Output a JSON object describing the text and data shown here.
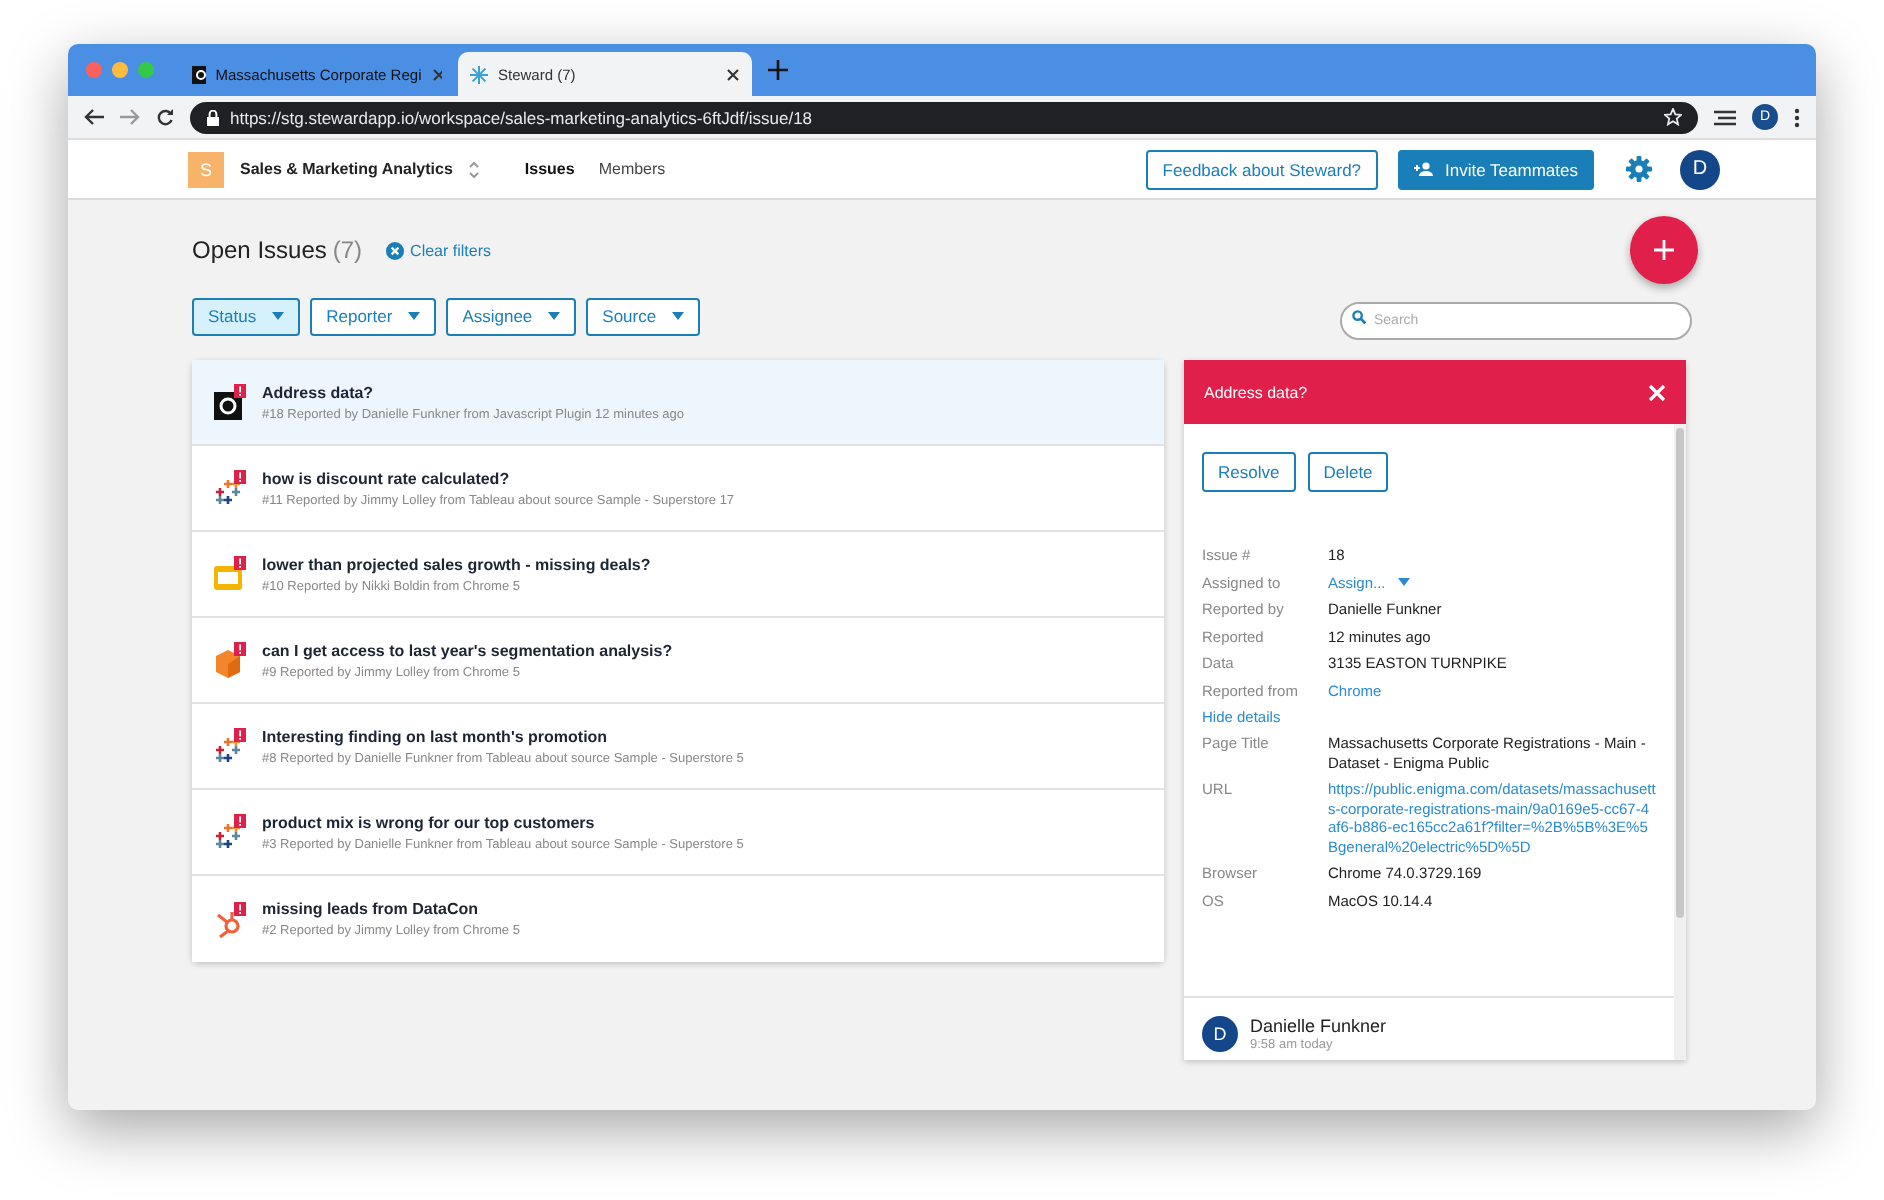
{
  "browser": {
    "tabs": [
      {
        "title": "Massachusetts Corporate Regi",
        "kind": "dark-tile",
        "selected": false
      },
      {
        "title": "Steward (7)",
        "kind": "sparkle",
        "selected": true
      }
    ],
    "url": "https://stg.stewardapp.io/workspace/sales-marketing-analytics-6ftJdf/issue/18",
    "profile_initial": "D"
  },
  "header": {
    "workspace": {
      "initial": "S",
      "name": "Sales & Marketing Analytics"
    },
    "nav": [
      {
        "label": "Issues",
        "selected": true
      },
      {
        "label": "Members",
        "selected": false
      }
    ],
    "feedback_button": "Feedback about Steward?",
    "invite_button": "Invite Teammates",
    "avatar_initial": "D"
  },
  "page": {
    "title": "Open Issues",
    "count": "(7)",
    "clear_filters": "Clear filters",
    "filters": [
      {
        "label": "Status",
        "active": true
      },
      {
        "label": "Reporter",
        "active": false
      },
      {
        "label": "Assignee",
        "active": false
      },
      {
        "label": "Source",
        "active": false
      }
    ],
    "search": {
      "placeholder": "Search"
    }
  },
  "issues": [
    {
      "title": "Address data?",
      "meta": "#18 Reported by Danielle Funkner from Javascript Plugin 12 minutes ago",
      "kind": "dark-tile",
      "selected": true
    },
    {
      "title": "how is discount rate calculated?",
      "meta": "#11 Reported by Jimmy Lolley from Tableau about source Sample - Superstore 17",
      "kind": "crosses",
      "selected": false
    },
    {
      "title": "lower than projected sales growth - missing deals?",
      "meta": "#10 Reported by Nikki Boldin from Chrome 5",
      "kind": "slide",
      "selected": false
    },
    {
      "title": "can I get access to last year's segmentation analysis?",
      "meta": "#9 Reported by Jimmy Lolley from Chrome 5",
      "kind": "cube",
      "selected": false
    },
    {
      "title": "Interesting finding on last month's promotion",
      "meta": "#8 Reported by Danielle Funkner from Tableau about source Sample - Superstore 5",
      "kind": "crosses",
      "selected": false
    },
    {
      "title": "product mix is wrong for our top customers",
      "meta": "#3 Reported by Danielle Funkner from Tableau about source Sample - Superstore 5",
      "kind": "crosses",
      "selected": false
    },
    {
      "title": "missing leads from DataCon",
      "meta": "#2 Reported by Jimmy Lolley from Chrome 5",
      "kind": "sprocket",
      "selected": false
    }
  ],
  "detail": {
    "title": "Address data?",
    "actions": [
      "Resolve",
      "Delete"
    ],
    "fields": [
      {
        "label": "Issue #",
        "value": "18",
        "kind": "text"
      },
      {
        "label": "Assigned to",
        "value": "Assign...",
        "kind": "dropdown"
      },
      {
        "label": "Reported by",
        "value": "Danielle Funkner",
        "kind": "text"
      },
      {
        "label": "Reported",
        "value": "12 minutes ago",
        "kind": "text"
      },
      {
        "label": "Data",
        "value": "3135 EASTON TURNPIKE",
        "kind": "text"
      },
      {
        "label": "Reported from",
        "value": "Chrome",
        "kind": "link"
      }
    ],
    "toggle": "Hide details",
    "more_fields": [
      {
        "label": "Page Title",
        "value": "Massachusetts Corporate Registrations - Main - Dataset - Enigma Public",
        "kind": "text"
      },
      {
        "label": "URL",
        "value": "https://public.enigma.com/datasets/massachusetts-corporate-registrations-main/9a0169e5-cc67-4af6-b886-ec165cc2a61f?filter=%2B%5B%3E%5Bgeneral%20electric%5D%5D",
        "kind": "link"
      },
      {
        "label": "Browser",
        "value": "Chrome 74.0.3729.169",
        "kind": "text"
      },
      {
        "label": "OS",
        "value": "MacOS 10.14.4",
        "kind": "text"
      }
    ],
    "comment": {
      "initial": "D",
      "author": "Danielle Funkner",
      "time": "9:58 am today"
    }
  }
}
